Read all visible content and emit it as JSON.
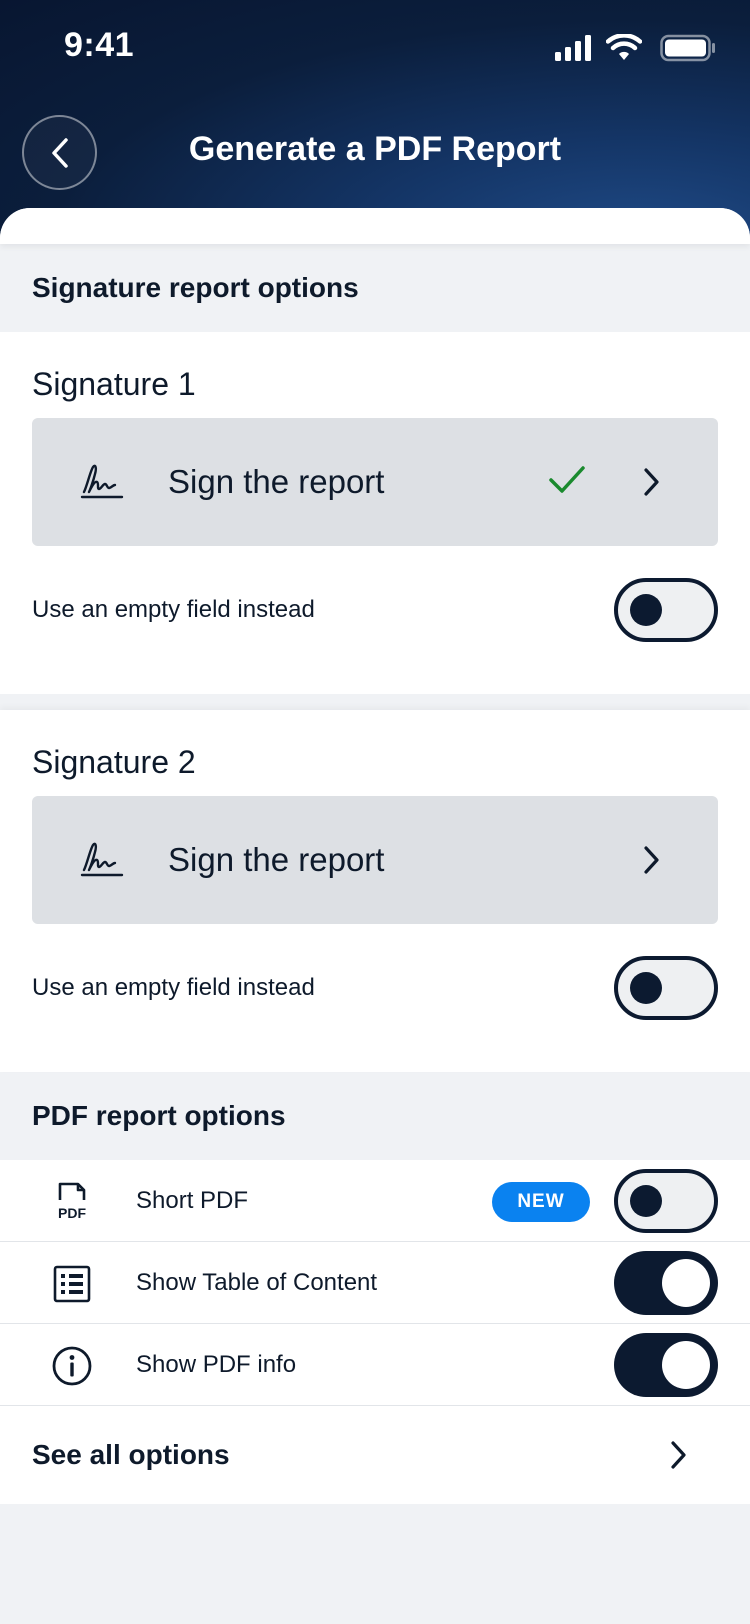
{
  "status_bar": {
    "time": "9:41"
  },
  "header": {
    "title": "Generate a PDF Report"
  },
  "signature_section": {
    "title": "Signature report options",
    "signatures": [
      {
        "title": "Signature 1",
        "action_label": "Sign the report",
        "signed": true,
        "empty_field_label": "Use an empty field instead",
        "empty_field_on": false
      },
      {
        "title": "Signature 2",
        "action_label": "Sign the report",
        "signed": false,
        "empty_field_label": "Use an empty field instead",
        "empty_field_on": false
      }
    ]
  },
  "pdf_section": {
    "title": "PDF report options",
    "options": [
      {
        "label": "Short PDF",
        "icon": "pdf-file-icon",
        "badge": "NEW",
        "on": false
      },
      {
        "label": "Show Table of Content",
        "icon": "table-of-contents-icon",
        "on": true
      },
      {
        "label": "Show PDF info",
        "icon": "info-icon",
        "on": true
      }
    ],
    "see_all_label": "See all options"
  },
  "colors": {
    "header_dark": "#081631",
    "accent_blue": "#0a82f0",
    "toggle_dark": "#0c1a30",
    "check_green": "#1a8a2e"
  }
}
